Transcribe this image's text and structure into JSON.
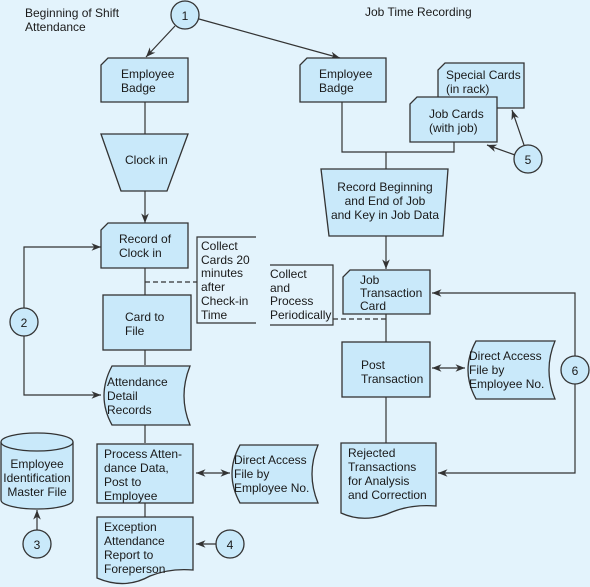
{
  "titles": {
    "left": [
      "Beginning of Shift",
      "Attendance"
    ],
    "right": "Job Time Recording"
  },
  "connectors": [
    "1",
    "2",
    "3",
    "4",
    "5",
    "6"
  ],
  "nodes": {
    "badge_left": [
      "Employee",
      "Badge"
    ],
    "clock_in": [
      "Clock in"
    ],
    "record_clock_in": [
      "Record of",
      "Clock in"
    ],
    "card_to_file": [
      "Card to",
      "File"
    ],
    "attendance_detail": [
      "Attendance",
      "Detail",
      "Records"
    ],
    "process_attendance": [
      "Process Atten-",
      "dance Data,",
      "Post to",
      "Employee"
    ],
    "exception_report": [
      "Exception",
      "Attendance",
      "Report to",
      "Foreperson"
    ],
    "direct_access_left": [
      "Direct Access",
      "File by",
      "Employee No."
    ],
    "master_file": [
      "Employee",
      "Identification",
      "Master File"
    ],
    "badge_right": [
      "Employee",
      "Badge"
    ],
    "special_cards": [
      "Special Cards",
      "(in rack)"
    ],
    "job_cards": [
      "Job Cards",
      "(with job)"
    ],
    "record_job": [
      "Record Beginning",
      "and End of Job",
      "and Key in Job Data"
    ],
    "job_transaction_card": [
      "Job",
      "Transaction",
      "Card"
    ],
    "post_transaction": [
      "Post",
      "Transaction"
    ],
    "direct_access_right": [
      "Direct Access",
      "File by",
      "Employee No."
    ],
    "rejected": [
      "Rejected",
      "Transactions",
      "for Analysis",
      "and Correction"
    ]
  },
  "annotations": {
    "collect_cards": [
      "Collect",
      "Cards 20",
      "minutes",
      "after",
      "Check-in",
      "Time"
    ],
    "collect_process": [
      "Collect",
      "and",
      "Process",
      "Periodically"
    ]
  },
  "colors": {
    "background": "#e3f3fc",
    "shape_fill": "#c9e9fa",
    "stroke": "#333333"
  }
}
